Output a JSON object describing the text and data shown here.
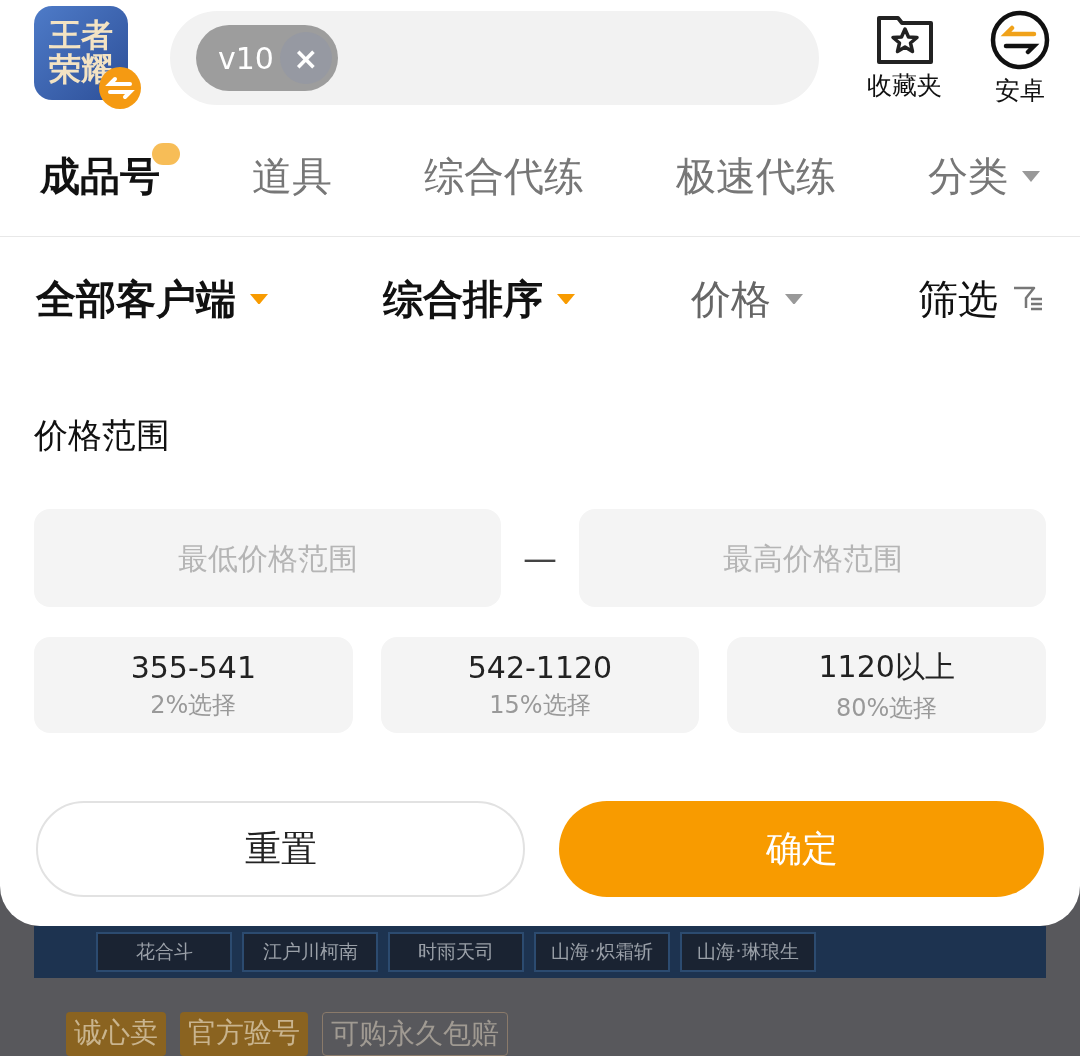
{
  "header": {
    "app_icon": {
      "text": "王者荣耀"
    },
    "search": {
      "chips": [
        {
          "label": "v10",
          "close": "×"
        }
      ]
    },
    "actions": [
      {
        "kind": "favorites",
        "label": "收藏夹"
      },
      {
        "kind": "platform",
        "label": "安卓"
      }
    ]
  },
  "tabs": [
    {
      "label": "成品号",
      "selected": true,
      "badge": true
    },
    {
      "label": "道具",
      "selected": false,
      "badge": false
    },
    {
      "label": "综合代练",
      "selected": false,
      "badge": false
    },
    {
      "label": "极速代练",
      "selected": false,
      "badge": false
    },
    {
      "label": "分类",
      "selected": false,
      "badge": false,
      "dropdown": true
    }
  ],
  "filters": [
    {
      "kind": "dropdown",
      "label": "全部客户端",
      "active": true
    },
    {
      "kind": "dropdown",
      "label": "综合排序",
      "active": true
    },
    {
      "kind": "dropdown",
      "label": "价格",
      "active": false
    },
    {
      "kind": "filter",
      "label": "筛选",
      "active": false
    }
  ],
  "price_panel": {
    "title": "价格范围",
    "min_placeholder": "最低价格范围",
    "separator": "—",
    "max_placeholder": "最高价格范围",
    "presets": [
      {
        "range": "355-541",
        "share": "2%选择",
        "selected": false
      },
      {
        "range": "542-1120",
        "share": "15%选择",
        "selected": false
      },
      {
        "range": "1120以上",
        "share": "80%选择",
        "selected": false
      }
    ],
    "reset": "重置",
    "confirm": "确定"
  },
  "background": {
    "skins": [
      "花合斗",
      "江户川柯南",
      "时雨天司",
      "山海·炽霜斩",
      "山海·琳琅生"
    ],
    "tags": [
      {
        "label": "诚心卖",
        "kind": "filled"
      },
      {
        "label": "官方验号",
        "kind": "filled"
      },
      {
        "label": "可购永久包赔",
        "kind": "outline"
      }
    ]
  }
}
